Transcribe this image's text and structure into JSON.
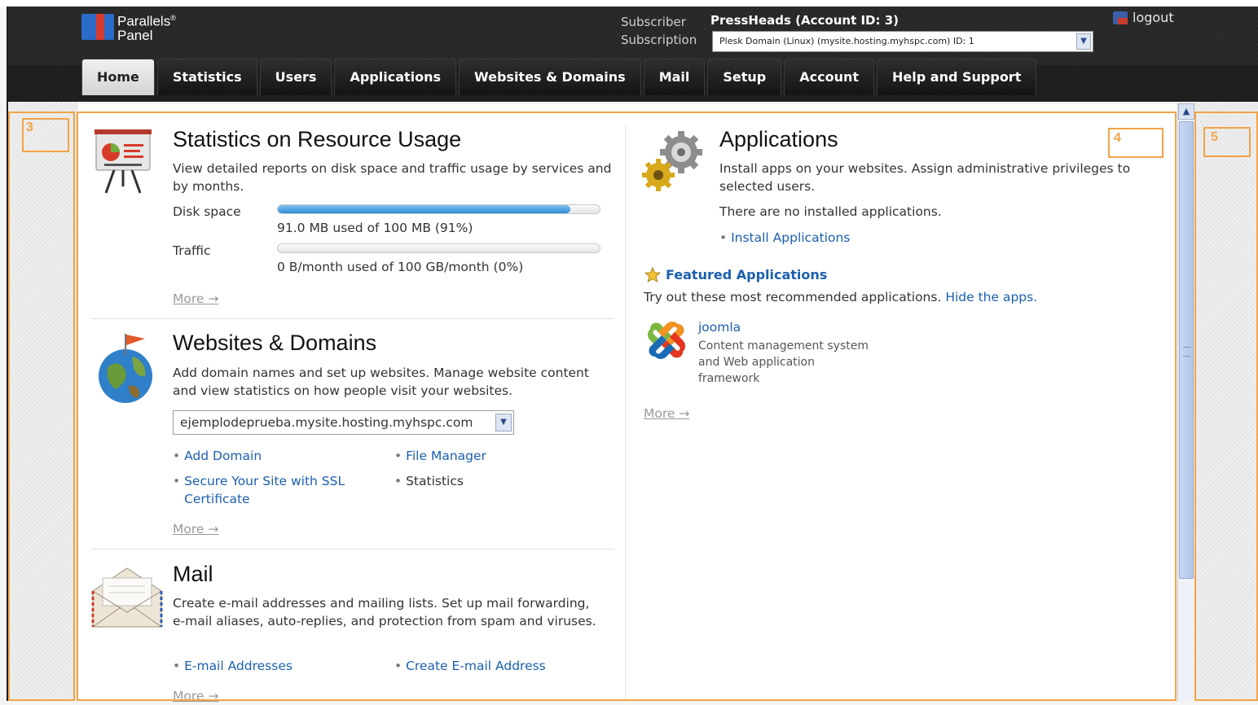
{
  "brand": {
    "name_line1": "Parallels",
    "reg": "®",
    "name_line2": "Panel"
  },
  "header": {
    "subscriber_label": "Subscriber",
    "subscription_label": "Subscription",
    "subscriber_name": "PressHeads (Account ID: 3)",
    "subscription_value": "Plesk Domain (Linux) (mysite.hosting.myhspc.com) ID: 1",
    "logout": "logout"
  },
  "tabs": [
    {
      "label": "Home",
      "active": true
    },
    {
      "label": "Statistics"
    },
    {
      "label": "Users"
    },
    {
      "label": "Applications"
    },
    {
      "label": "Websites & Domains"
    },
    {
      "label": "Mail"
    },
    {
      "label": "Setup"
    },
    {
      "label": "Account"
    },
    {
      "label": "Help and Support"
    }
  ],
  "annotations": {
    "left": "3",
    "middle": "4",
    "right": "5"
  },
  "statistics": {
    "title": "Statistics on Resource Usage",
    "description": "View detailed reports on disk space and traffic usage by services and by months.",
    "disk_label": "Disk space",
    "disk_usage": "91.0 MB used of 100 MB (91%)",
    "disk_percent": 91,
    "traffic_label": "Traffic",
    "traffic_usage": "0 B/month used of 100 GB/month (0%)",
    "traffic_percent": 0,
    "more": "More →"
  },
  "websites": {
    "title": "Websites & Domains",
    "description": "Add domain names and set up websites. Manage website content and view statistics on how people visit your websites.",
    "domain_selected": "ejemplodeprueba.mysite.hosting.myhspc.com",
    "add_domain": "Add Domain",
    "file_manager": "File Manager",
    "ssl": "Secure Your Site with SSL Certificate",
    "statistics": "Statistics",
    "more": "More →"
  },
  "mail": {
    "title": "Mail",
    "description": "Create e-mail addresses and mailing lists. Set up mail forwarding, e-mail aliases, auto-replies, and protection from spam and viruses.",
    "email_addresses": "E-mail Addresses",
    "create_email": "Create E-mail Address",
    "more": "More →"
  },
  "applications": {
    "title": "Applications",
    "description": "Install apps on your websites. Assign administrative privileges to selected users.",
    "none_installed": "There are no installed applications.",
    "install": "Install Applications",
    "featured_title": "Featured Applications",
    "featured_text": "Try out these most recommended applications.",
    "hide": "Hide the apps.",
    "app_name": "joomla",
    "app_desc_1": "Content management system",
    "app_desc_2": "and Web application",
    "app_desc_3": "framework",
    "more": "More →"
  },
  "icons": [
    "presentation-chart-icon",
    "globe-flag-icon",
    "envelope-icon",
    "gears-icon",
    "star-icon",
    "joomla-icon",
    "logout-icon",
    "chevron-down-icon",
    "chevron-up-icon"
  ]
}
